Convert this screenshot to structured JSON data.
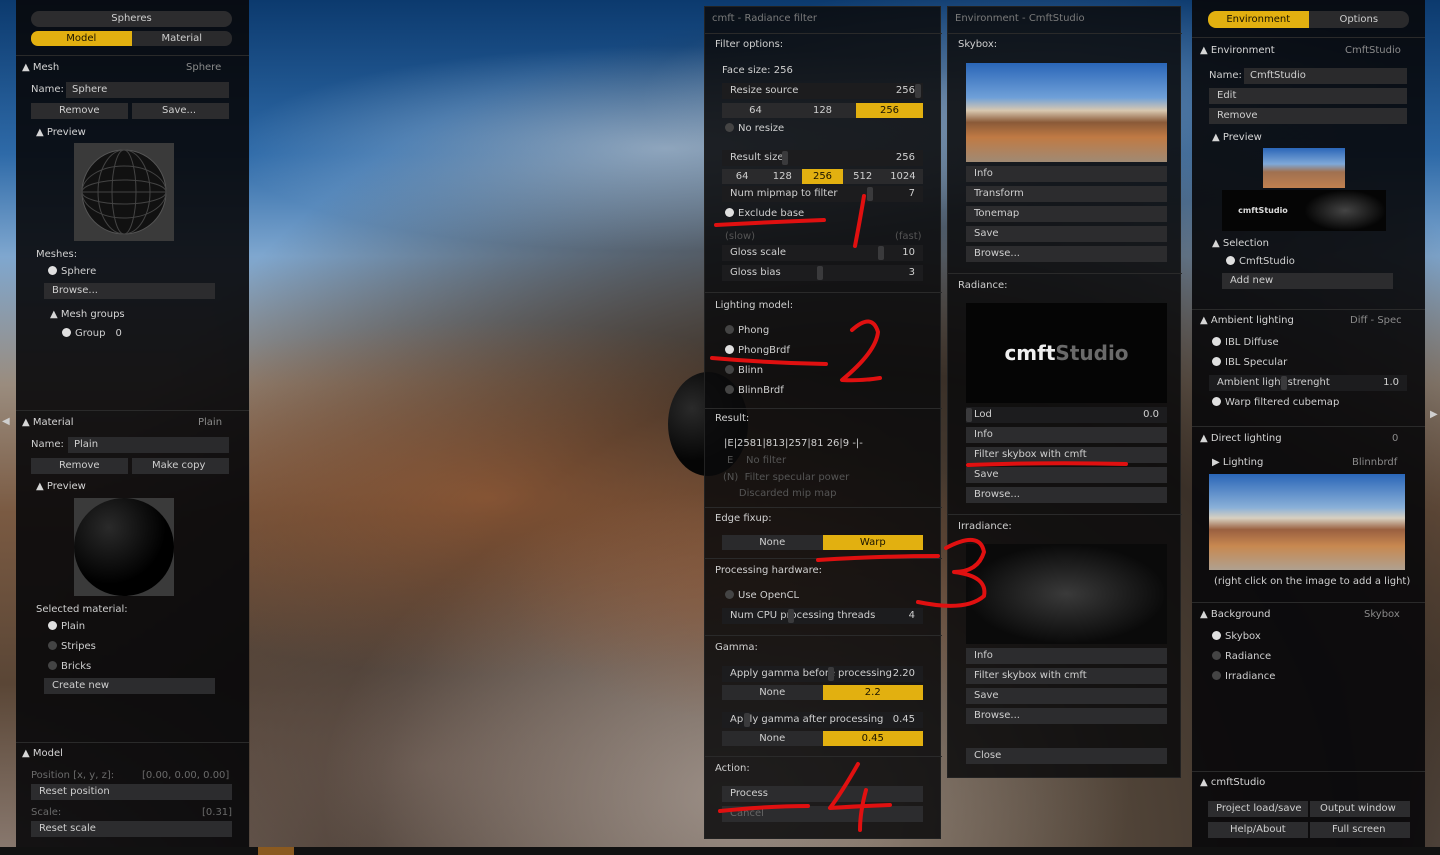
{
  "left": {
    "top_label": "Spheres",
    "tabs": [
      "Model",
      "Material"
    ],
    "mesh": {
      "title": "Mesh",
      "value": "Sphere",
      "name_label": "Name:",
      "name_value": "Sphere",
      "remove": "Remove",
      "save": "Save...",
      "preview": "Preview",
      "meshes_label": "Meshes:",
      "mesh_item": "Sphere",
      "browse": "Browse...",
      "mesh_groups": "Mesh groups",
      "group": "Group",
      "group_num": "0"
    },
    "material": {
      "title": "Material",
      "value": "Plain",
      "name_label": "Name:",
      "name_value": "Plain",
      "remove": "Remove",
      "make_copy": "Make copy",
      "preview": "Preview",
      "selected_label": "Selected material:",
      "items": [
        "Plain",
        "Stripes",
        "Bricks"
      ],
      "create_new": "Create new"
    },
    "model": {
      "title": "Model",
      "position_label": "Position [x, y, z]:",
      "position_value": "[0.00, 0.00, 0.00]",
      "reset_position": "Reset position",
      "scale_label": "Scale:",
      "scale_value": "[0.31]",
      "reset_scale": "Reset scale"
    }
  },
  "cmft": {
    "title": "cmft - Radiance filter",
    "filter_options": "Filter options:",
    "face_size": "Face size: 256",
    "resize_source": "Resize source",
    "resize_source_value": "256",
    "face_opts": [
      "64",
      "128",
      "256"
    ],
    "no_resize": "No resize",
    "result_size": "Result size",
    "result_size_value": "256",
    "result_opts": [
      "64",
      "128",
      "256",
      "512",
      "1024"
    ],
    "mipmap": "Num mipmap to filter",
    "mipmap_value": "7",
    "exclude_base": "Exclude base",
    "slow": "(slow)",
    "fast": "(fast)",
    "gloss_scale": "Gloss scale",
    "gloss_scale_value": "10",
    "gloss_bias": "Gloss bias",
    "gloss_bias_value": "3",
    "lighting_model": "Lighting model:",
    "models": [
      "Phong",
      "PhongBrdf",
      "Blinn",
      "BlinnBrdf"
    ],
    "result": "Result:",
    "result_line": "|E|2581|813|257|81 26|9 -|-",
    "result_notes": [
      "E    No filter",
      "(N)  Filter specular power",
      "     Discarded mip map"
    ],
    "edge_fixup": "Edge fixup:",
    "edge_opts": [
      "None",
      "Warp"
    ],
    "processing_hw": "Processing hardware:",
    "use_opencl": "Use OpenCL",
    "cpu_threads": "Num CPU processing threads",
    "cpu_threads_value": "4",
    "gamma": "Gamma:",
    "gamma_before": "Apply gamma before processing",
    "gamma_before_value": "2.20",
    "gamma_before_opts": [
      "None",
      "2.2"
    ],
    "gamma_after": "Apply gamma after processing",
    "gamma_after_value": "0.45",
    "gamma_after_opts": [
      "None",
      "0.45"
    ],
    "action": "Action:",
    "process": "Process",
    "cancel": "Cancel"
  },
  "env": {
    "title": "Environment - CmftStudio",
    "skybox": "Skybox:",
    "skybox_btns": [
      "Info",
      "Transform",
      "Tonemap",
      "Save",
      "Browse..."
    ],
    "radiance": "Radiance:",
    "logo_a": "cmft",
    "logo_b": "Studio",
    "lod": "Lod",
    "lod_value": "0.0",
    "radiance_btns": [
      "Info",
      "Filter skybox with cmft",
      "Save",
      "Browse..."
    ],
    "irradiance": "Irradiance:",
    "irradiance_btns": [
      "Info",
      "Filter skybox with cmft",
      "Save",
      "Browse..."
    ],
    "close": "Close"
  },
  "right": {
    "tabs": [
      "Environment",
      "Options"
    ],
    "env_title": "Environment",
    "env_value": "CmftStudio",
    "name_label": "Name:",
    "name_value": "CmftStudio",
    "edit": "Edit",
    "remove": "Remove",
    "preview": "Preview",
    "mini_logo": "cmftStudio",
    "selection": "Selection",
    "selection_item": "CmftStudio",
    "add_new": "Add new",
    "ambient": "Ambient lighting",
    "ambient_value": "Diff - Spec",
    "ibl_diffuse": "IBL Diffuse",
    "ibl_specular": "IBL Specular",
    "ambient_strength": "Ambient light strenght",
    "ambient_strength_value": "1.0",
    "warp": "Warp filtered cubemap",
    "direct": "Direct lighting",
    "direct_value": "0",
    "lighting": "Lighting",
    "lighting_value": "Blinnbrdf",
    "hint": "(right click on the image to add a light)",
    "background": "Background",
    "background_value": "Skybox",
    "bg_opts": [
      "Skybox",
      "Radiance",
      "Irradiance"
    ],
    "cmftstudio": "cmftStudio",
    "bottom_btns": [
      [
        "Project load/save",
        "Output window"
      ],
      [
        "Help/About",
        "Full screen"
      ]
    ]
  },
  "annotations": [
    "1",
    "2",
    "3",
    "4"
  ],
  "colors": {
    "accent": "#e2b010",
    "panel": "#0a0a0c",
    "annotation": "#e01010"
  }
}
